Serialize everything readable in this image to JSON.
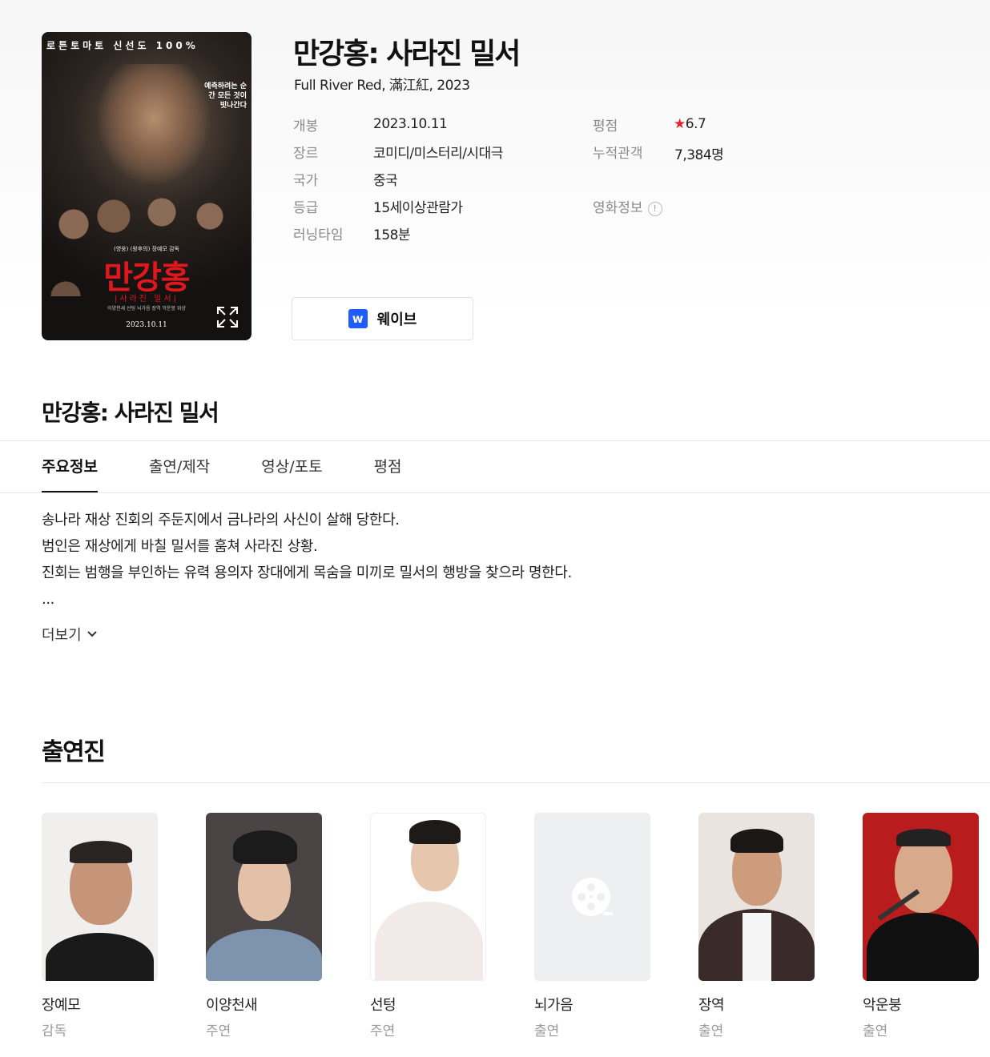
{
  "colors": {
    "accent_star": "#e8202a",
    "wavve_blue": "#1f5bff",
    "tab_underline": "#111111"
  },
  "poster": {
    "badge": "로튼토마토 신선도 100%",
    "tagline": "예측하려는 순간 모든 것이 빗나간다",
    "director_line": "(영웅) (왕후의) 장예모 감독",
    "title": "만강홍",
    "subtitle": "|사라진 밀서|",
    "cast_line": "이양천새 선팅 뇌가음 장역 악운붕 위샹",
    "date": "2023.10.11",
    "expand_icon": "expand-icon"
  },
  "movie": {
    "title": "만강홍: 사라진 밀서",
    "subtitle": "Full River Red, 滿江紅, 2023"
  },
  "info": {
    "release_label": "개봉",
    "release": "2023.10.11",
    "genre_label": "장르",
    "genre": "코미디/미스터리/시대극",
    "country_label": "국가",
    "country": "중국",
    "rating_label": "등급",
    "rating": "15세이상관람가",
    "runtime_label": "러닝타임",
    "runtime": "158분",
    "score_label": "평점",
    "score": "6.7",
    "audience_label": "누적관객",
    "audience": "7,384명",
    "movieinfo_label": "영화정보"
  },
  "watch": {
    "provider": "웨이브",
    "logo_letter": "w"
  },
  "section_title": "만강홍: 사라진 밀서",
  "tabs": [
    {
      "label": "주요정보",
      "active": true
    },
    {
      "label": "출연/제작",
      "active": false
    },
    {
      "label": "영상/포토",
      "active": false
    },
    {
      "label": "평점",
      "active": false
    }
  ],
  "synopsis": {
    "lines": [
      "송나라 재상 진회의 주둔지에서 금나라의 사신이 살해 당한다.",
      "범인은 재상에게 바칠 밀서를 훔쳐 사라진 상황.",
      "진회는 범행을 부인하는 유력 용의자 장대에게 목숨을 미끼로 밀서의 행방을 찾으라 명한다.",
      "..."
    ],
    "more": "더보기"
  },
  "cast_section": {
    "title": "출연진",
    "members": [
      {
        "name": "장예모",
        "role": "감독"
      },
      {
        "name": "이양천새",
        "role": "주연"
      },
      {
        "name": "선텅",
        "role": "주연"
      },
      {
        "name": "뇌가음",
        "role": "출연"
      },
      {
        "name": "장역",
        "role": "출연"
      },
      {
        "name": "악운붕",
        "role": "출연"
      }
    ]
  }
}
